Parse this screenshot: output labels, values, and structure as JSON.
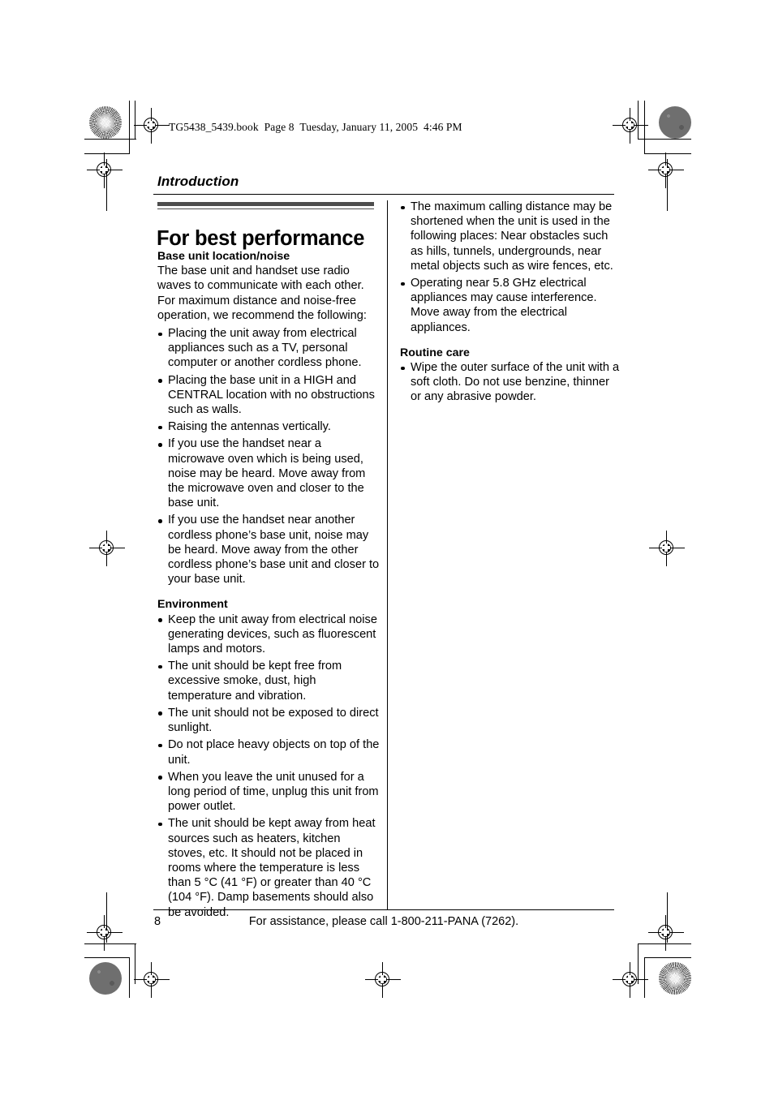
{
  "book_stamp": "TG5438_5439.book  Page 8  Tuesday, January 11, 2005  4:46 PM",
  "chapter": "Introduction",
  "section_title": "For best performance",
  "left_column": {
    "subhead_1": "Base unit location/noise",
    "intro_paragraph": "The base unit and handset use radio waves to communicate with each other. For maximum distance and noise-free operation, we recommend the following:",
    "bullets_1": [
      "Placing the unit away from electrical appliances such as a TV, personal computer or another cordless phone.",
      "Placing the base unit in a HIGH and CENTRAL location with no obstructions such as walls.",
      "Raising the antennas vertically.",
      "If you use the handset near a microwave oven which is being used, noise may be heard. Move away from the microwave oven and closer to the base unit.",
      "If you use the handset near another cordless phone’s base unit, noise may be heard. Move away from the other cordless phone’s base unit and closer to your base unit."
    ],
    "subhead_2": "Environment",
    "bullets_2": [
      "Keep the unit away from electrical noise generating devices, such as fluorescent lamps and motors.",
      "The unit should be kept free from excessive smoke, dust, high temperature and vibration.",
      "The unit should not be exposed to direct sunlight.",
      "Do not place heavy objects on top of the unit.",
      "When you leave the unit unused for a long period of time, unplug this unit from power outlet.",
      "The unit should be kept away from heat sources such as heaters, kitchen stoves, etc. It should not be placed in rooms where the temperature is less than 5 °C (41 °F) or greater than 40 °C (104 °F). Damp basements should also be avoided."
    ]
  },
  "right_column": {
    "bullets_1": [
      "The maximum calling distance may be shortened when the unit is used in the following places: Near obstacles such as hills, tunnels, undergrounds, near metal objects such as wire fences, etc.",
      "Operating near 5.8 GHz electrical appliances may cause interference. Move away from the electrical appliances."
    ],
    "subhead_1": "Routine care",
    "bullets_2": [
      "Wipe the outer surface of the unit with a soft cloth. Do not use benzine, thinner or any abrasive powder."
    ]
  },
  "footer": {
    "page_number": "8",
    "assistance_text": "For assistance, please call 1-800-211-PANA (7262)."
  },
  "colors": {
    "title_bar": "#4d4d4d",
    "text": "#000000",
    "background": "#ffffff"
  }
}
